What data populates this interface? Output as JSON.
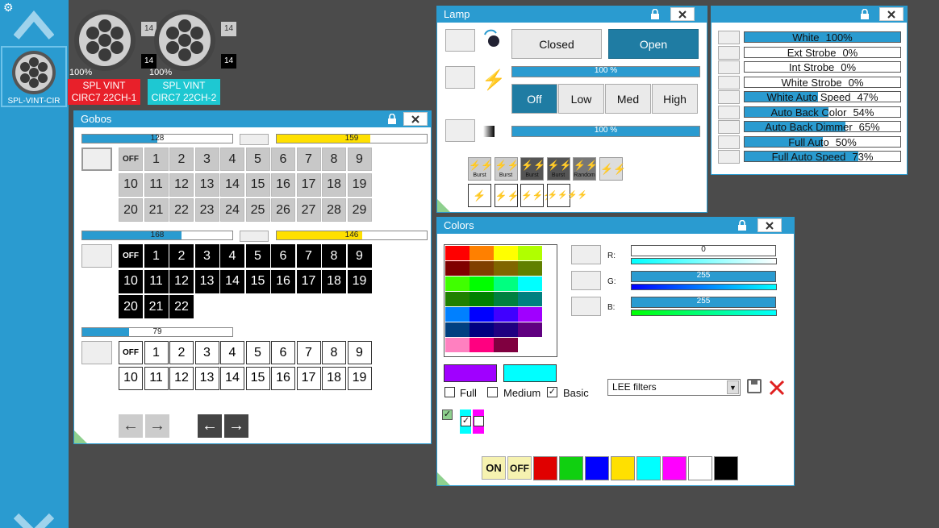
{
  "colors": {
    "accent": "#2a9bd0",
    "desktop": "#4b4b4b",
    "yellow": "#ffe000"
  },
  "sidebar": {
    "device_label": "SPL-VINT-CIR",
    "icons": [
      "gear-icon",
      "chevron-up-icon",
      "chevron-down-icon"
    ]
  },
  "fixtures": [
    {
      "percent": "100%",
      "badge_top": "14",
      "badge_bottom": "14",
      "name_line1": "SPL VINT",
      "name_line2": "CIRC7 22CH-1",
      "color": "#e8202a"
    },
    {
      "percent": "100%",
      "badge_top": "14",
      "badge_bottom": "14",
      "name_line1": "SPL VINT",
      "name_line2": "CIRC7 22CH-2",
      "color": "#1ec8d2"
    }
  ],
  "gobos": {
    "title": "Gobos",
    "wheel1": {
      "slider_a": "128",
      "slider_b": "159",
      "off": "OFF",
      "items": [
        "1",
        "2",
        "3",
        "4",
        "5",
        "6",
        "7",
        "8",
        "9",
        "10",
        "11",
        "12",
        "13",
        "14",
        "15",
        "16",
        "17",
        "18",
        "19",
        "20",
        "21",
        "22",
        "23",
        "24",
        "25",
        "26",
        "27",
        "28",
        "29"
      ]
    },
    "wheel2": {
      "slider_a": "168",
      "slider_b": "146",
      "off": "OFF",
      "items": [
        "1",
        "2",
        "3",
        "4",
        "5",
        "6",
        "7",
        "8",
        "9",
        "10",
        "11",
        "12",
        "13",
        "14",
        "15",
        "16",
        "17",
        "18",
        "19",
        "20",
        "21",
        "22"
      ]
    },
    "wheel3": {
      "slider_a": "79",
      "off": "OFF",
      "items": [
        "1",
        "2",
        "3",
        "4",
        "5",
        "6",
        "7",
        "8",
        "9",
        "10",
        "11",
        "12",
        "13",
        "14",
        "15",
        "16",
        "17",
        "18",
        "19"
      ]
    }
  },
  "lamp": {
    "title": "Lamp",
    "closed": "Closed",
    "open": "Open",
    "slider1": "100 %",
    "slider2": "100 %",
    "modes": [
      "Off",
      "Low",
      "Med",
      "High"
    ],
    "effects": [
      "Burst",
      "Burst",
      "Burst",
      "Burst",
      "Random"
    ]
  },
  "strobe": {
    "rows": [
      {
        "label": "White",
        "value": "100%",
        "level": 1.0
      },
      {
        "label": "Ext Strobe",
        "value": "0%",
        "level": 0
      },
      {
        "label": "Int Strobe",
        "value": "0%",
        "level": 0
      },
      {
        "label": "White Strobe",
        "value": "0%",
        "level": 0
      },
      {
        "label": "White Auto Speed",
        "value": "47%",
        "level": 0.47
      },
      {
        "label": "Auto Back Color",
        "value": "54%",
        "level": 0.54
      },
      {
        "label": "Auto Back Dimmer",
        "value": "65%",
        "level": 0.65
      },
      {
        "label": "Full Auto",
        "value": "50%",
        "level": 0.5
      },
      {
        "label": "Full Auto Speed",
        "value": "73%",
        "level": 0.73
      }
    ]
  },
  "colors_win": {
    "title": "Colors",
    "r_label": "R:",
    "g_label": "G:",
    "b_label": "B:",
    "r_value": "0",
    "g_value": "255",
    "b_value": "255",
    "palette": [
      "#ff0000",
      "#ff8000",
      "#ffff00",
      "#b0ff00",
      "#800000",
      "#804000",
      "#806600",
      "#608000",
      "#40ff00",
      "#00ff00",
      "#00ff80",
      "#00ffff",
      "#208000",
      "#008000",
      "#008040",
      "#008080",
      "#0080ff",
      "#0000ff",
      "#4000ff",
      "#a000ff",
      "#004080",
      "#000080",
      "#200080",
      "#600080",
      "#ff80c0",
      "#ff0080",
      "#800040",
      "#ffffff"
    ],
    "preview_left": "#a000ff",
    "preview_right": "#00ffff",
    "full": "Full",
    "medium": "Medium",
    "basic": "Basic",
    "filter": "LEE filters",
    "on": "ON",
    "off": "OFF",
    "swatches": [
      "#e00000",
      "#10d010",
      "#0000ff",
      "#ffe000",
      "#00ffff",
      "#ff00ff",
      "#ffffff",
      "#000000"
    ]
  }
}
